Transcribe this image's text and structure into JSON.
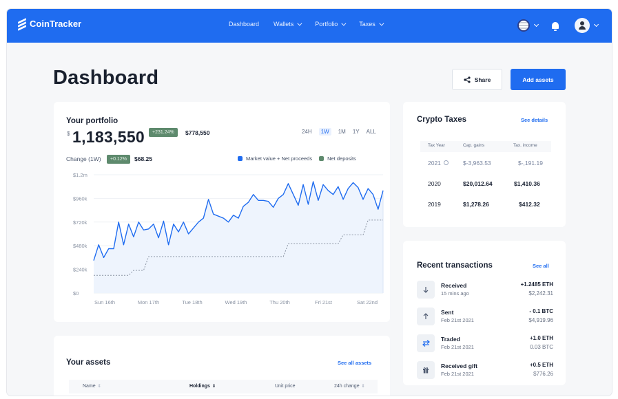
{
  "app": {
    "brand": "CoinTracker"
  },
  "nav": {
    "items": [
      {
        "label": "Dashboard",
        "has_menu": false
      },
      {
        "label": "Wallets",
        "has_menu": true
      },
      {
        "label": "Portfolio",
        "has_menu": true
      },
      {
        "label": "Taxes",
        "has_menu": true
      }
    ],
    "icons": [
      "us-flag-icon",
      "bell-icon",
      "user-avatar-icon"
    ]
  },
  "page": {
    "title": "Dashboard"
  },
  "actions": {
    "share_label": "Share",
    "add_assets_label": "Add assets"
  },
  "portfolio": {
    "title": "Your portfolio",
    "currency": "$",
    "value": "1,183,550",
    "total_change_pct": "+231.24%",
    "total_change_amt": "$778,550",
    "change_label": "Change (1W)",
    "change_pct": "+0.12%",
    "change_amt": "$68.25",
    "ranges": [
      "24H",
      "1W",
      "1M",
      "1Y",
      "ALL"
    ],
    "active_range": "1W",
    "legend": {
      "market": "Market value + Net proceeds",
      "deposits": "Net deposits"
    }
  },
  "chart_data": {
    "type": "line",
    "x_ticks": [
      "Sun 16th",
      "Mon 17th",
      "Tue 18th",
      "Wed 19th",
      "Thu 20th",
      "Fri 21st",
      "Sat 22nd"
    ],
    "y_ticks": [
      "$1.2m",
      "$960k",
      "$720k",
      "$480k",
      "$240k",
      "$0"
    ],
    "ylim": [
      0,
      1200000
    ],
    "series": [
      {
        "name": "Market value + Net proceeds",
        "color": "#1f6cf0",
        "style": "solid",
        "values": [
          330000,
          490000,
          360000,
          450000,
          450000,
          720000,
          490000,
          700000,
          570000,
          720000,
          640000,
          650000,
          700000,
          560000,
          730000,
          490000,
          700000,
          620000,
          720000,
          600000,
          660000,
          720000,
          760000,
          950000,
          800000,
          780000,
          760000,
          720000,
          790000,
          760000,
          880000,
          920000,
          1000000,
          940000,
          940000,
          930000,
          870000,
          960000,
          1000000,
          1110000,
          1000000,
          890000,
          1100000,
          900000,
          1130000,
          940000,
          1100000,
          1040000,
          1000000,
          1080000,
          950000,
          1060000,
          1120000,
          1070000,
          950000,
          1060000,
          1000000,
          850000,
          1040000
        ]
      },
      {
        "name": "Net deposits",
        "color": "#8a93a3",
        "style": "dashed",
        "values": [
          180000,
          180000,
          180000,
          180000,
          180000,
          180000,
          180000,
          180000,
          230000,
          230000,
          230000,
          370000,
          370000,
          370000,
          370000,
          370000,
          370000,
          370000,
          370000,
          370000,
          370000,
          370000,
          370000,
          370000,
          370000,
          370000,
          370000,
          370000,
          370000,
          370000,
          370000,
          370000,
          370000,
          370000,
          370000,
          370000,
          370000,
          370000,
          370000,
          500000,
          500000,
          500000,
          500000,
          500000,
          500000,
          500000,
          500000,
          500000,
          500000,
          500000,
          590000,
          590000,
          590000,
          590000,
          590000,
          740000,
          740000,
          740000,
          740000
        ]
      }
    ],
    "grid": true,
    "legend": "top-right"
  },
  "taxes": {
    "title": "Crypto Taxes",
    "see_details": "See details",
    "headers": [
      "Tax Year",
      "Cap. gains",
      "Tax. income"
    ],
    "rows": [
      {
        "year": "2021",
        "gains": "$-3,963.53",
        "income": "$-,191.19",
        "muted": true
      },
      {
        "year": "2020",
        "gains": "$20,012.64",
        "income": "$1,410.36",
        "muted": false
      },
      {
        "year": "2019",
        "gains": "$1,278.26",
        "income": "$412.32",
        "muted": false
      }
    ]
  },
  "transactions": {
    "title": "Recent transactions",
    "see_all": "See all",
    "items": [
      {
        "type": "Received",
        "time": "15 mins ago",
        "amount": "+1.2485 ETH",
        "usd": "$2,242.31",
        "icon": "arrow-down-icon"
      },
      {
        "type": "Sent",
        "time": "Feb 21st 2021",
        "amount": "- 0.1 BTC",
        "usd": "$4,919.96",
        "icon": "arrow-up-icon"
      },
      {
        "type": "Traded",
        "time": "Feb 21st 2021",
        "amount": "+1.0 ETH",
        "usd": "0.03 BTC",
        "icon": "swap-arrows-icon"
      },
      {
        "type": "Received gift",
        "time": "Feb 21st 2021",
        "amount": "+0.5 ETH",
        "usd": "$776.26",
        "icon": "gift-icon"
      }
    ]
  },
  "assets": {
    "title": "Your assets",
    "see_all": "See all assets",
    "columns": [
      "Name",
      "Holdings",
      "Unit price",
      "24h change"
    ]
  }
}
